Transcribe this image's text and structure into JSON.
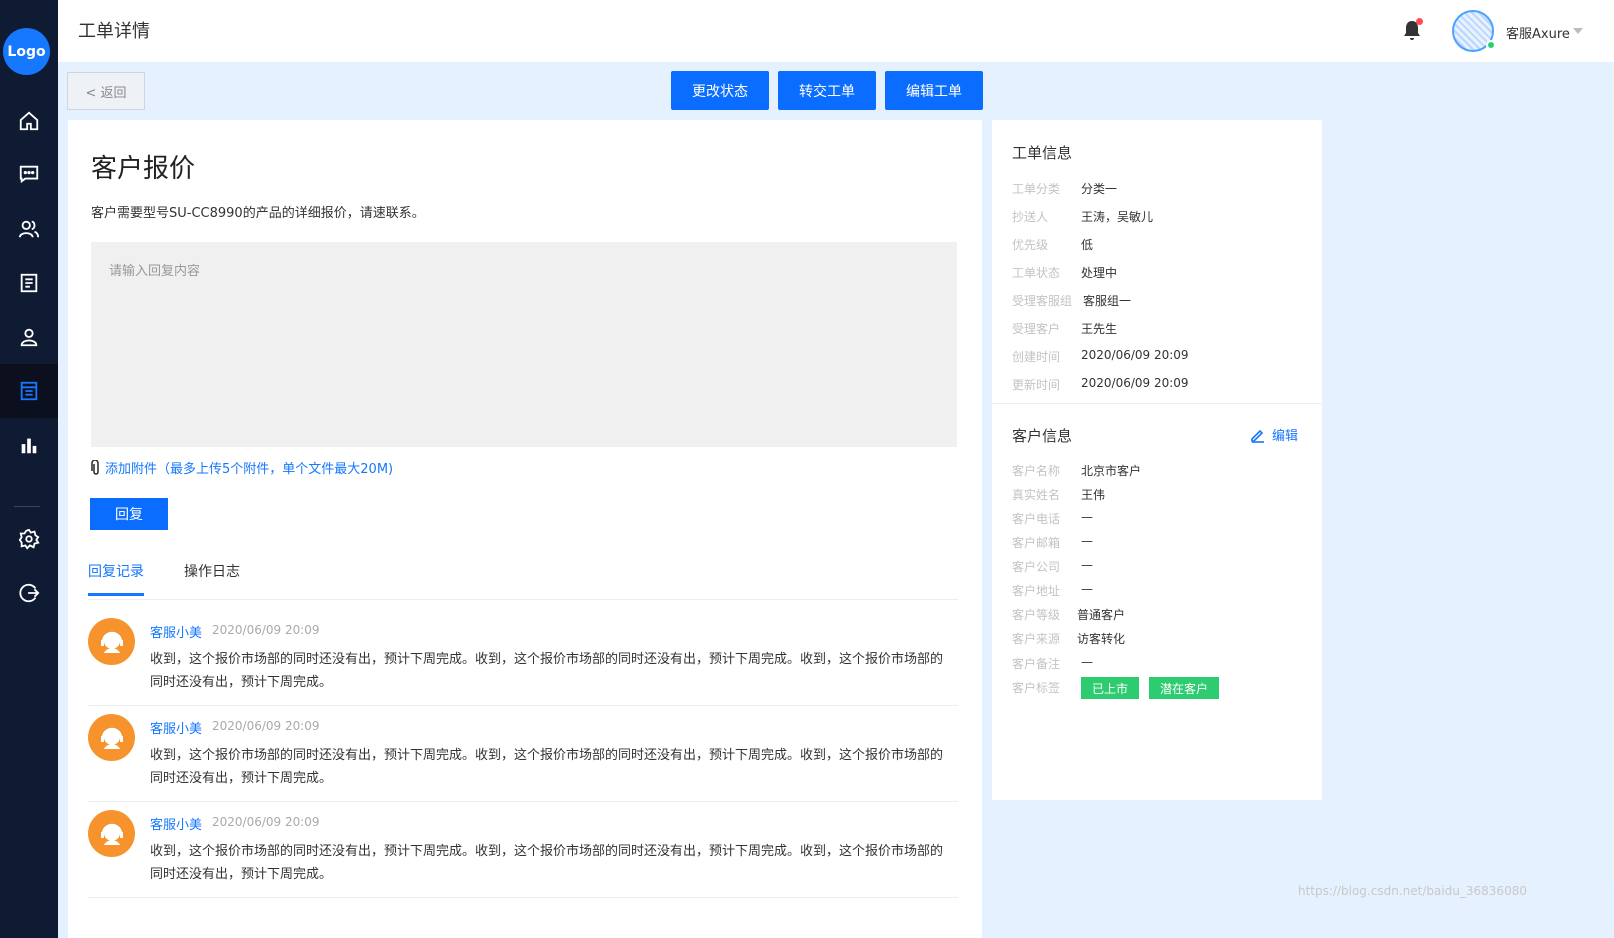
{
  "sidebar": {
    "logo": "Logo",
    "items": [
      {
        "icon": "home-icon"
      },
      {
        "icon": "message-icon"
      },
      {
        "icon": "users-icon"
      },
      {
        "icon": "document-icon"
      },
      {
        "icon": "user-icon"
      },
      {
        "icon": "ticket-icon",
        "active": true
      },
      {
        "icon": "chart-icon"
      },
      {
        "icon": "settings-icon"
      },
      {
        "icon": "logout-icon"
      }
    ]
  },
  "header": {
    "title": "工单详情",
    "user_name": "客服Axure",
    "notification_icon": "bell-icon"
  },
  "toolbar": {
    "back_label": "< 返回",
    "change_status_label": "更改状态",
    "transfer_label": "转交工单",
    "edit_label": "编辑工单"
  },
  "ticket": {
    "title": "客户报价",
    "description": "客户需要型号SU-CC8990的产品的详细报价，请速联系。",
    "reply_placeholder": "请输入回复内容",
    "attach_label": "添加附件（最多上传5个附件，单个文件最大20M)",
    "reply_button": "回复"
  },
  "tabs": [
    {
      "label": "回复记录",
      "active": true
    },
    {
      "label": "操作日志",
      "active": false
    }
  ],
  "replies": [
    {
      "author": "客服小美",
      "time": "2020/06/09 20:09",
      "text": "收到，这个报价市场部的同时还没有出，预计下周完成。收到，这个报价市场部的同时还没有出，预计下周完成。收到，这个报价市场部的同时还没有出，预计下周完成。"
    },
    {
      "author": "客服小美",
      "time": "2020/06/09 20:09",
      "text": "收到，这个报价市场部的同时还没有出，预计下周完成。收到，这个报价市场部的同时还没有出，预计下周完成。收到，这个报价市场部的同时还没有出，预计下周完成。"
    },
    {
      "author": "客服小美",
      "time": "2020/06/09 20:09",
      "text": "收到，这个报价市场部的同时还没有出，预计下周完成。收到，这个报价市场部的同时还没有出，预计下周完成。收到，这个报价市场部的同时还没有出，预计下周完成。"
    }
  ],
  "ticket_info": {
    "title": "工单信息",
    "rows": [
      {
        "label": "工单分类",
        "value": "分类一"
      },
      {
        "label": "抄送人",
        "value": "王涛，吴敏儿"
      },
      {
        "label": "优先级",
        "value": "低"
      },
      {
        "label": "工单状态",
        "value": "处理中"
      },
      {
        "label": "受理客服组",
        "value": "客服组一"
      },
      {
        "label": "受理客户",
        "value": "王先生"
      },
      {
        "label": "创建时间",
        "value": "2020/06/09 20:09"
      },
      {
        "label": "更新时间",
        "value": "2020/06/09 20:09"
      }
    ]
  },
  "customer_info": {
    "title": "客户信息",
    "edit_label": "编辑",
    "rows": [
      {
        "label": "客户名称",
        "value": "北京市客户"
      },
      {
        "label": "真实姓名",
        "value": "王伟"
      },
      {
        "label": "客户电话",
        "value": "—"
      },
      {
        "label": "客户邮箱",
        "value": "—"
      },
      {
        "label": "客户公司",
        "value": "—"
      },
      {
        "label": "客户地址",
        "value": "—"
      },
      {
        "label": "客户等级",
        "value": "普通客户"
      },
      {
        "label": "客户来源",
        "value": "访客转化"
      },
      {
        "label": "客户备注",
        "value": "—"
      },
      {
        "label": "客户标签",
        "value": ""
      }
    ],
    "tags": [
      "已上市",
      "潜在客户"
    ]
  },
  "watermark": "https://blog.csdn.net/baidu_36836080",
  "colors": {
    "primary": "#0b6dff",
    "sidebar": "#0f1a33",
    "tag": "#2ecc71",
    "avatar": "#f7932d"
  }
}
